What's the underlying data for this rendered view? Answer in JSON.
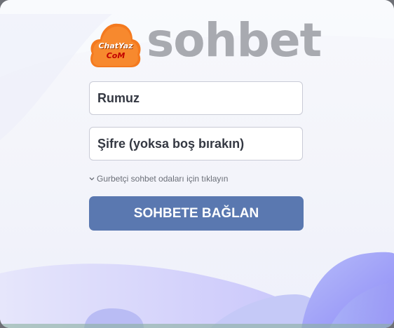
{
  "logo": {
    "badge_line1": "ChatYaz",
    "badge_line2": "CoM",
    "wordmark": "sohbet",
    "badge_color": "#f47a1f",
    "wordmark_color": "#a8aab0"
  },
  "form": {
    "nickname_placeholder": "Rumuz",
    "password_placeholder": "Şifre (yoksa boş bırakın)",
    "expat_link": "Gurbetçi sohbet odaları için tıklayın",
    "expat_icon": "chevron-down-icon",
    "submit_label": "SOHBETE BAĞLAN",
    "submit_color": "#5a78b0"
  }
}
